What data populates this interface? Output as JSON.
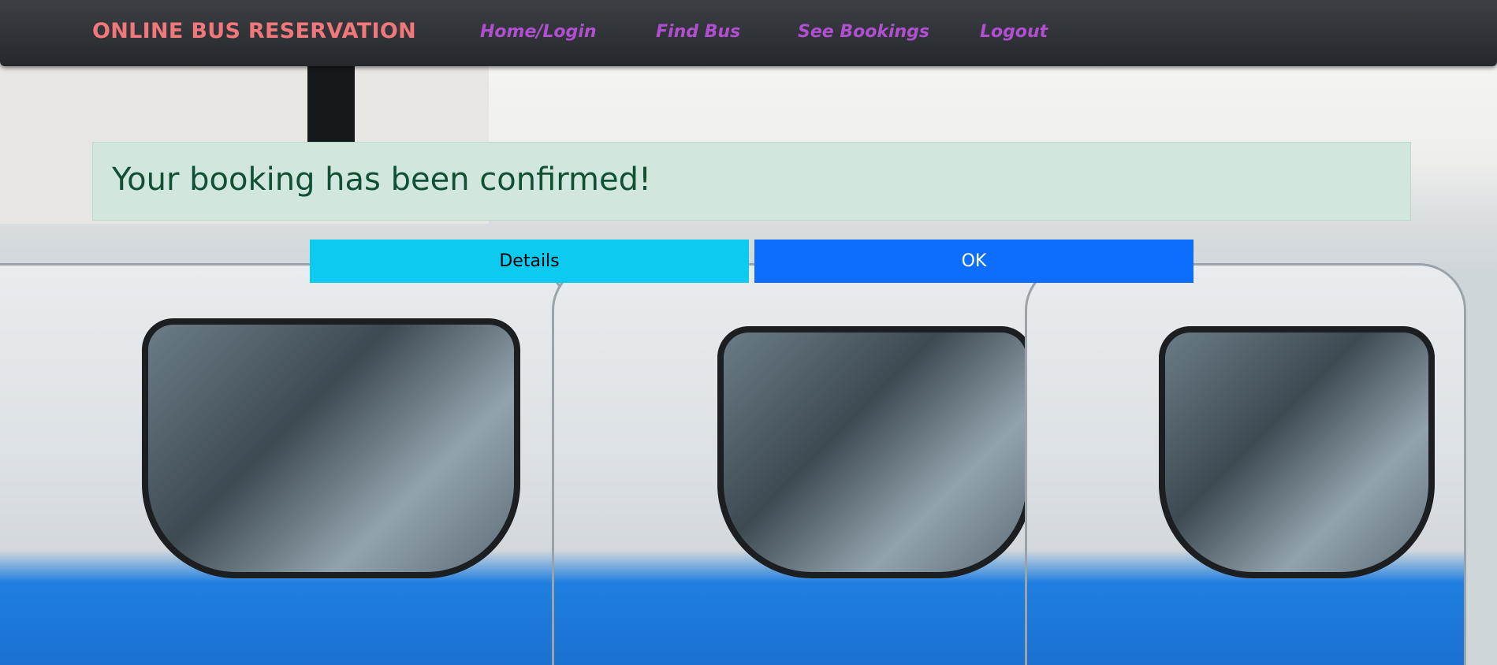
{
  "navbar": {
    "brand": "ONLINE BUS RESERVATION",
    "links": [
      {
        "label": "Home/Login"
      },
      {
        "label": "Find Bus"
      },
      {
        "label": "See Bookings"
      },
      {
        "label": "Logout"
      }
    ],
    "brand_color": "#f0787a",
    "link_color": "#b04fd0"
  },
  "alert": {
    "message": "Your booking has been confirmed!",
    "background": "#d1e7dd",
    "text_color": "#0f5132"
  },
  "actions": {
    "details_label": "Details",
    "ok_label": "OK",
    "details_color": "#0dcaf0",
    "ok_color": "#0d6efd"
  }
}
